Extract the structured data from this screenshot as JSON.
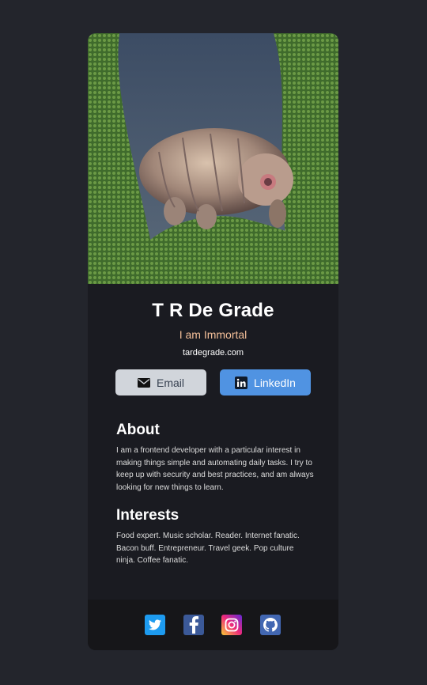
{
  "profile": {
    "name": "T R De Grade",
    "tagline": "I am Immortal",
    "website": "tardegrade.com"
  },
  "buttons": {
    "email_label": "Email",
    "linkedin_label": "LinkedIn"
  },
  "about": {
    "title": "About",
    "text": "I am a frontend developer with a particular interest in making things simple and automating daily tasks. I try to keep up with security and best practices, and am always looking for new things to learn."
  },
  "interests": {
    "title": "Interests",
    "text": "Food expert. Music scholar. Reader. Internet fanatic. Bacon buff. Entrepreneur. Travel geek. Pop culture ninja. Coffee fanatic."
  },
  "social": [
    {
      "name": "twitter",
      "icon": "twitter-icon"
    },
    {
      "name": "facebook",
      "icon": "facebook-icon"
    },
    {
      "name": "instagram",
      "icon": "instagram-icon"
    },
    {
      "name": "github",
      "icon": "github-icon"
    }
  ],
  "colors": {
    "background": "#23252c",
    "card": "#1a1b21",
    "footer": "#161619",
    "tagline": "#f3bf99",
    "linkedin": "#5093e2",
    "email_button": "#d1d5db"
  }
}
